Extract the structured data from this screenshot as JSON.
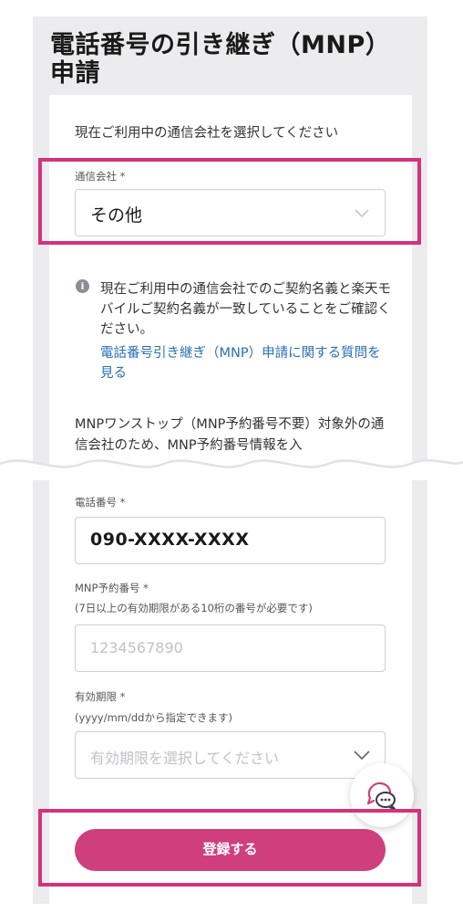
{
  "page": {
    "title": "電話番号の引き継ぎ（MNP）申請"
  },
  "carrier_section": {
    "lead": "現在ご利用中の通信会社を選択してください",
    "label": "通信会社 *",
    "value": "その他"
  },
  "notice": {
    "text": "現在ご利用中の通信会社でのご契約名義と楽天モバイルご契約名義が一致していることをご確認ください。",
    "link": "電話番号引き継ぎ（MNP）申請に関する質問を見る"
  },
  "onestop_note": "MNPワンストップ（MNP予約番号不要）対象外の通信会社のため、MNP予約番号情報を入",
  "phone_field": {
    "label": "電話番号 *",
    "value": "090-XXXX-XXXX"
  },
  "mnp_field": {
    "label": "MNP予約番号 *",
    "hint": "(7日以上の有効期限がある10桁の番号が必要です)",
    "placeholder": "1234567890"
  },
  "expiry_field": {
    "label": "有効期限 *",
    "hint": "(yyyy/mm/ddから指定できます)",
    "placeholder": "有効期限を選択してください"
  },
  "submit_label": "登録する",
  "colors": {
    "accent": "#cf3f7d",
    "highlight": "#d6317a",
    "link": "#2a6fb5"
  },
  "icons": {
    "info": "info-icon",
    "chevron": "chevron-down-icon",
    "chat": "chat-support-icon"
  }
}
